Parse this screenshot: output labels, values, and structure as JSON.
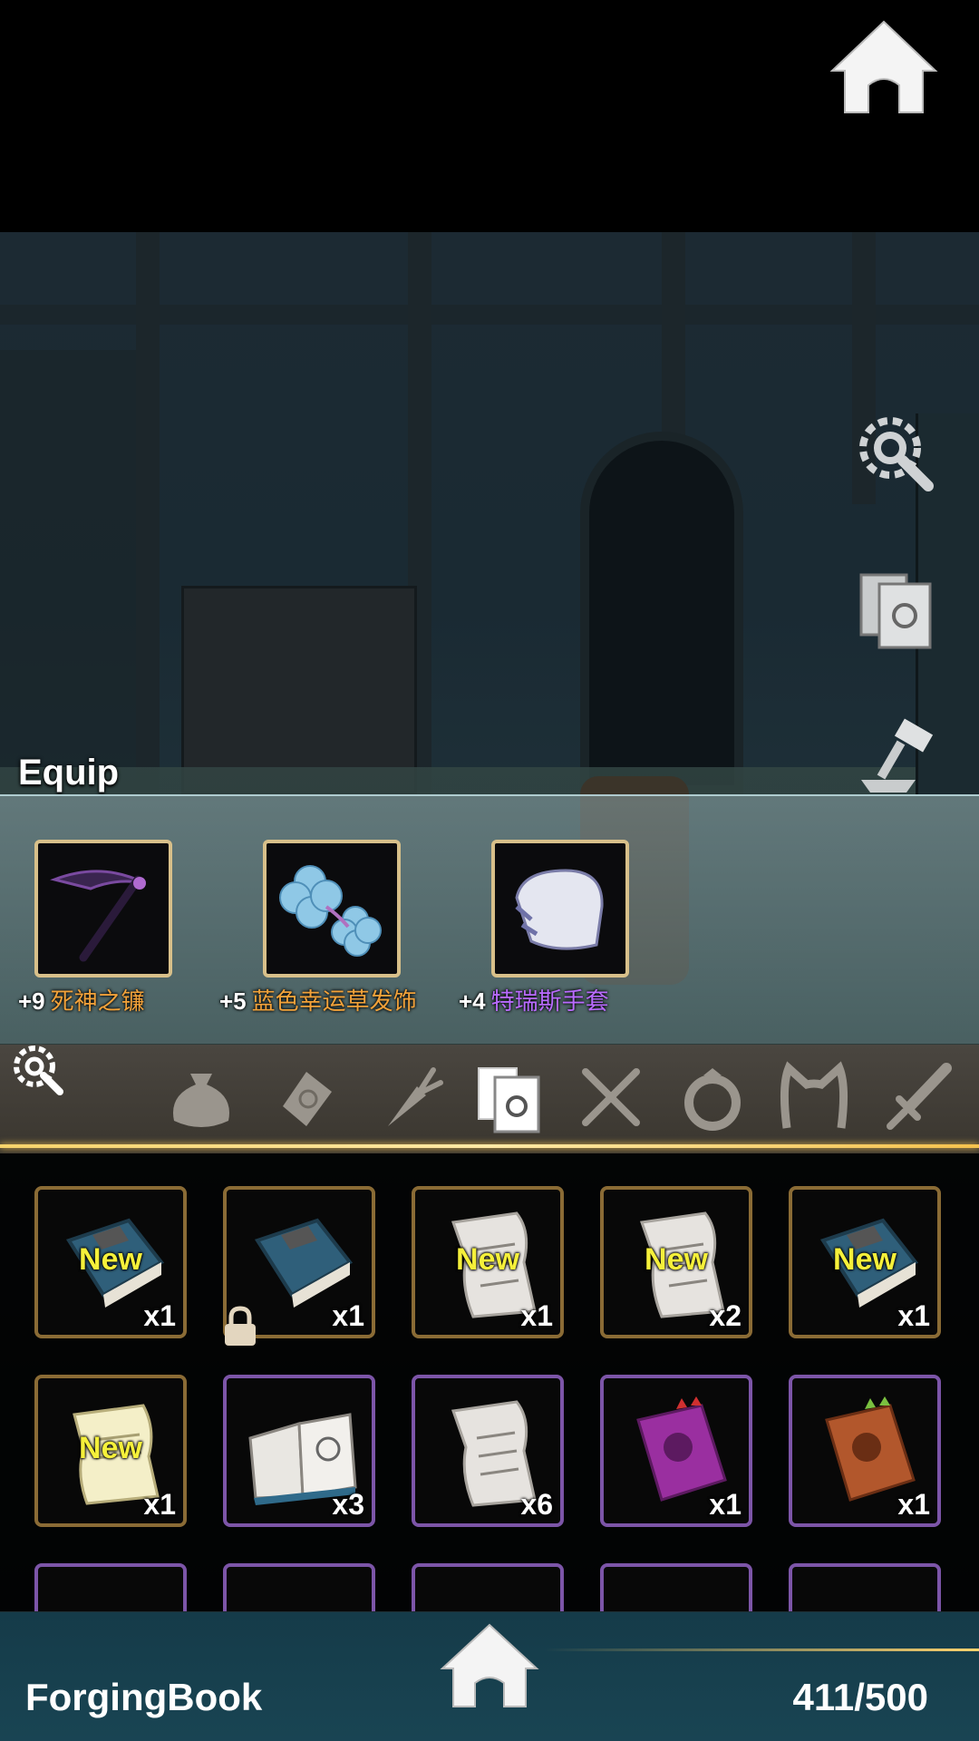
{
  "equip": {
    "title": "Equip",
    "items": [
      {
        "level": "+9",
        "name": "死神之镰",
        "name_color": "#f2a23a",
        "icon": "scythe-icon"
      },
      {
        "level": "+5",
        "name": "蓝色幸运草发饰",
        "name_color": "#f2a23a",
        "icon": "clover-hairpin-icon"
      },
      {
        "level": "+4",
        "name": "特瑞斯手套",
        "name_color": "#b96bff",
        "icon": "gauntlet-icon"
      }
    ]
  },
  "categories": [
    {
      "name": "bag",
      "icon": "bag-icon"
    },
    {
      "name": "material",
      "icon": "ore-icon"
    },
    {
      "name": "food",
      "icon": "carrot-icon"
    },
    {
      "name": "book",
      "icon": "book-icon",
      "active": true
    },
    {
      "name": "cooking",
      "icon": "utensils-icon"
    },
    {
      "name": "ring",
      "icon": "ring-icon"
    },
    {
      "name": "headband",
      "icon": "cat-ears-icon"
    },
    {
      "name": "weapon",
      "icon": "sword-icon"
    }
  ],
  "grid": {
    "items": [
      {
        "icon": "blue-book-icon",
        "qty": "x1",
        "new": "New",
        "rarity": "gold"
      },
      {
        "icon": "blue-book-icon",
        "qty": "x1",
        "new": "",
        "rarity": "gold",
        "locked": true
      },
      {
        "icon": "scroll-icon",
        "qty": "x1",
        "new": "New",
        "rarity": "gold"
      },
      {
        "icon": "scroll-icon",
        "qty": "x2",
        "new": "New",
        "rarity": "gold"
      },
      {
        "icon": "blue-book-icon",
        "qty": "x1",
        "new": "New",
        "rarity": "gold"
      },
      {
        "icon": "yellow-scroll-icon",
        "qty": "x1",
        "new": "New",
        "rarity": "gold"
      },
      {
        "icon": "open-book-icon",
        "qty": "x3",
        "new": "",
        "rarity": "purple"
      },
      {
        "icon": "scroll-icon",
        "qty": "x6",
        "new": "",
        "rarity": "purple"
      },
      {
        "icon": "purple-book-icon",
        "qty": "x1",
        "new": "",
        "rarity": "purple"
      },
      {
        "icon": "orange-book-icon",
        "qty": "x1",
        "new": "",
        "rarity": "purple"
      }
    ]
  },
  "footer": {
    "book_name": "ForgingBook",
    "capacity": "411/500"
  }
}
